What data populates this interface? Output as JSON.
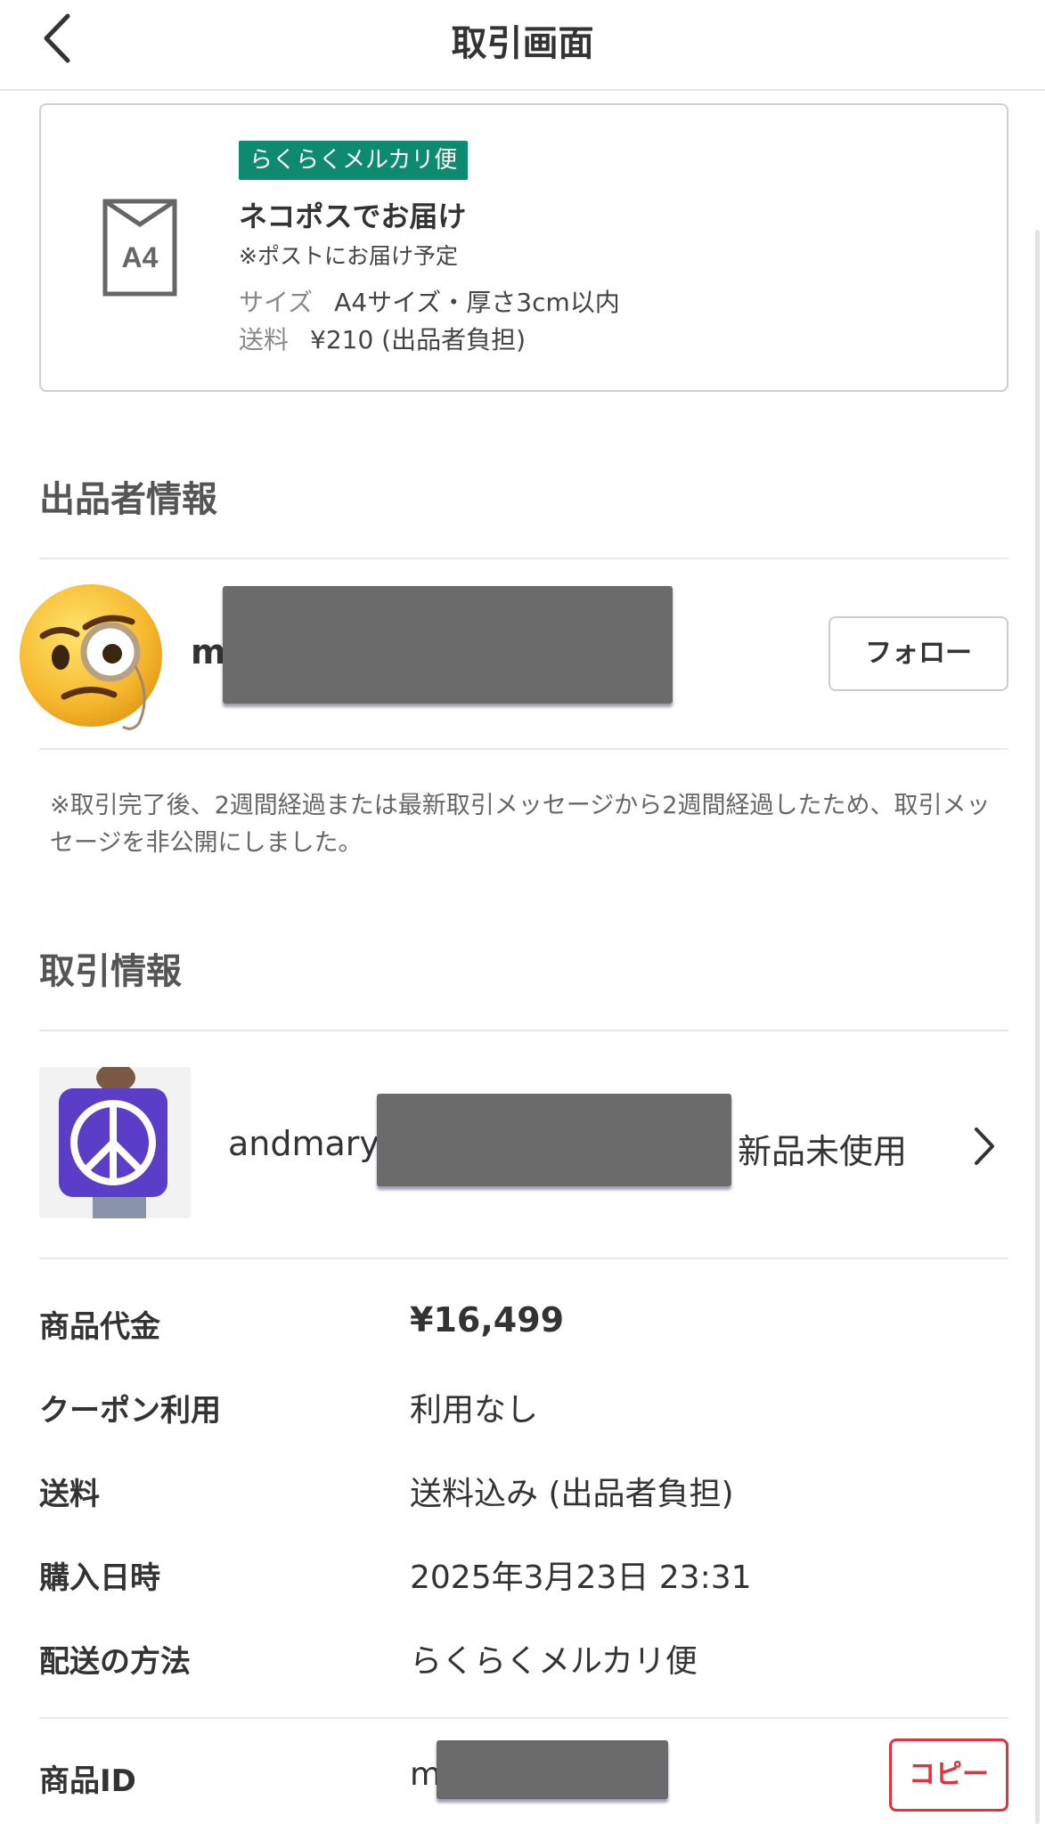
{
  "header": {
    "title": "取引画面",
    "back_icon": "chevron-left-icon"
  },
  "shipping": {
    "icon_label": "A4",
    "badge": "らくらくメルカリ便",
    "method": "ネコポスでお届け",
    "note": "※ポストにお届け予定",
    "size_label": "サイズ",
    "size_value": "A4サイズ・厚さ3cm以内",
    "fee_label": "送料",
    "fee_value": "¥210 (出品者負担)",
    "badge_color": "#0d8a6f"
  },
  "seller": {
    "section_title": "出品者情報",
    "avatar_icon": "face-with-monocle-emoji-icon",
    "name_visible": "m",
    "follow_label": "フォロー"
  },
  "notice": "※取引完了後、2週間経過または最新取引メッセージから2週間経過したため、取引メッセージを非公開にしました。",
  "transaction": {
    "section_title": "取引情報",
    "item": {
      "thumb_icon": "peace-sign-icon",
      "title_visible": "andmary",
      "condition": "新品未使用"
    },
    "rows": [
      {
        "label": "商品代金",
        "value": "¥16,499"
      },
      {
        "label": "クーポン利用",
        "value": "利用なし"
      },
      {
        "label": "送料",
        "value": "送料込み (出品者負担)"
      },
      {
        "label": "購入日時",
        "value": "2025年3月23日 23:31"
      },
      {
        "label": "配送の方法",
        "value": "らくらくメルカリ便"
      }
    ],
    "product_id_label": "商品ID",
    "product_id_visible": "m",
    "copy_label": "コピー",
    "copy_color": "#e03340"
  }
}
